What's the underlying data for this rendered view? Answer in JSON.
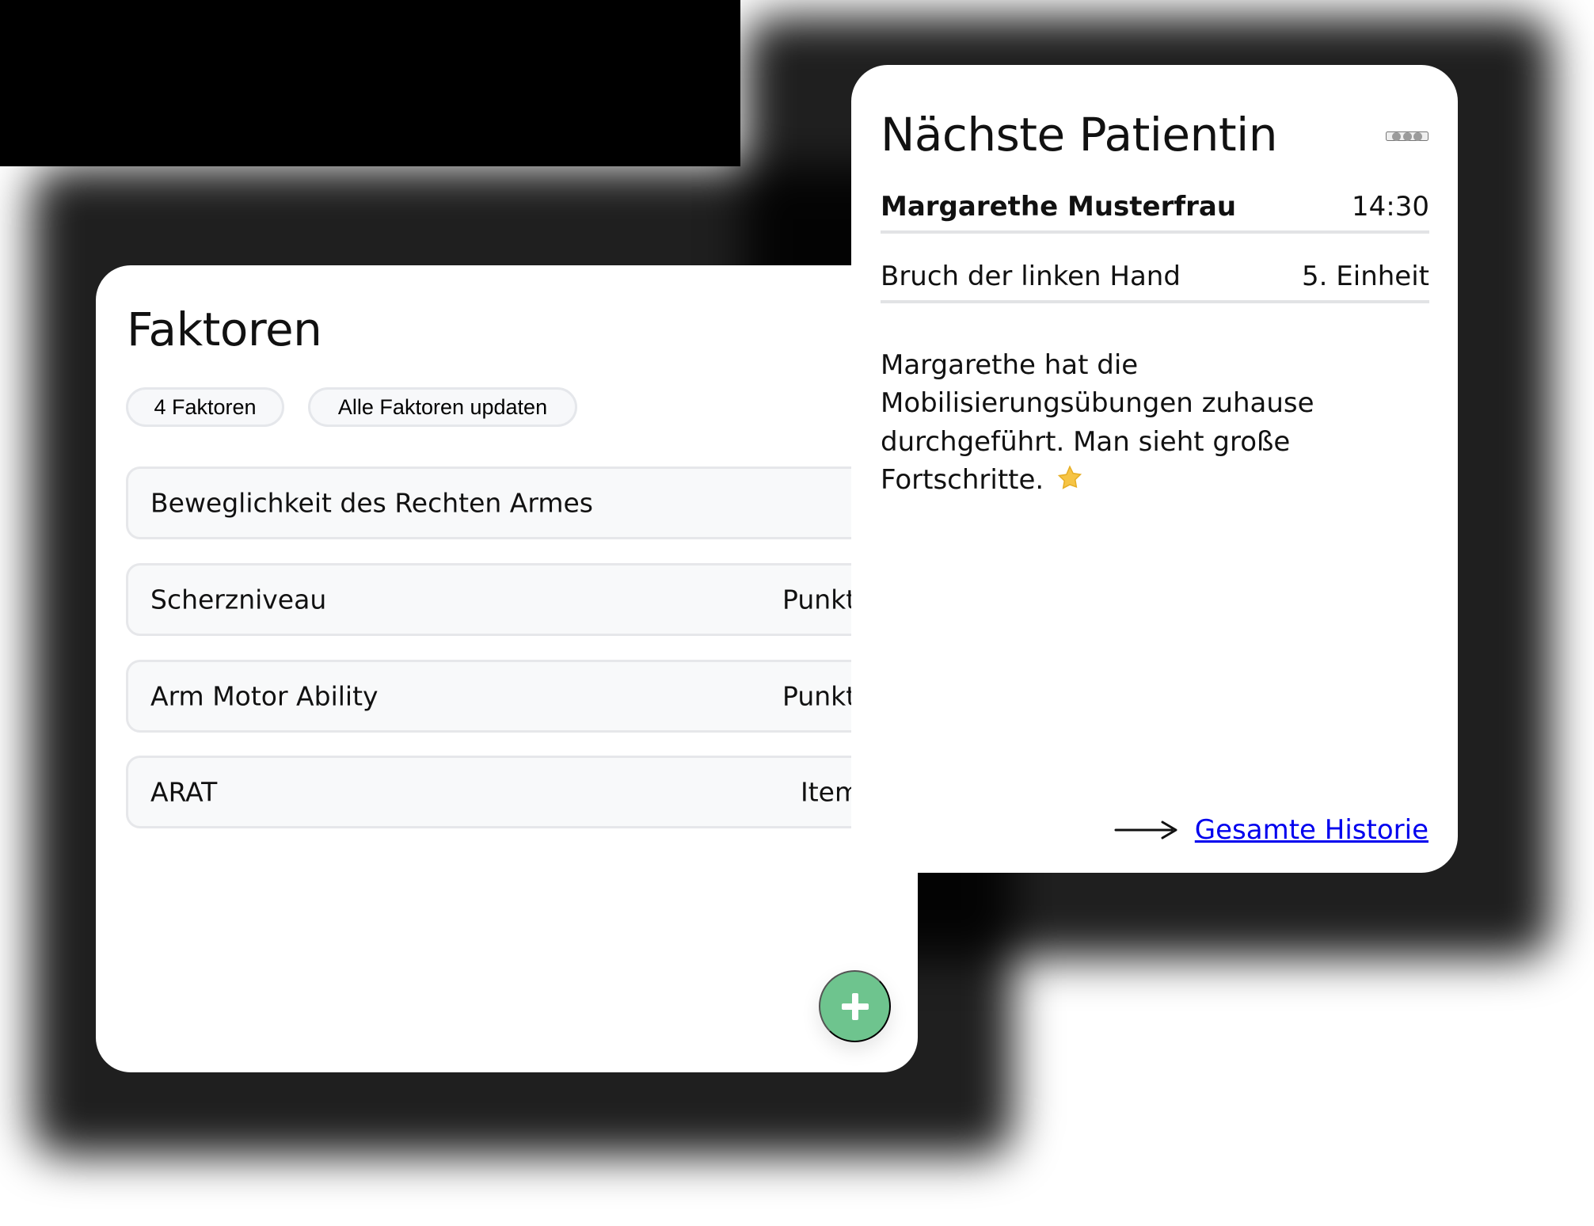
{
  "factors_card": {
    "title": "Faktoren",
    "chips": {
      "count": "4 Faktoren",
      "update": "Alle Faktoren updaten"
    },
    "rows": [
      {
        "label": "Beweglichkeit des Rechten Armes",
        "unit": ""
      },
      {
        "label": "Scherzniveau",
        "unit": "Punkt"
      },
      {
        "label": "Arm Motor Ability",
        "unit": "Punkt"
      },
      {
        "label": "ARAT",
        "unit": "Item"
      }
    ],
    "add_button_icon": "plus-icon",
    "add_button_color": "#6ec48e"
  },
  "patient_card": {
    "title": "Nächste Patientin",
    "menu_icon": "more-horizontal-icon",
    "patient_name": "Margarethe Musterfrau",
    "time": "14:30",
    "diagnosis": "Bruch der linken Hand",
    "session": "5. Einheit",
    "note": "Margarethe hat die Mobilisierungsübungen zuhause durchgeführt. Man sieht große Fortschritte.",
    "note_icon": "star-icon",
    "history_link": "Gesamte Historie",
    "history_icon": "arrow-right-icon"
  },
  "colors": {
    "background_black": "#000000",
    "card_background": "#ffffff",
    "border_gray": "#e5e7eb",
    "accent_green": "#6ec48e",
    "star_yellow": "#f6c445"
  }
}
